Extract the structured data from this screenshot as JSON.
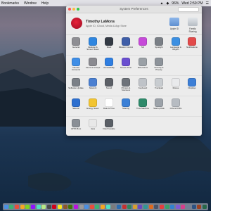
{
  "menubar": {
    "items": [
      "Bookmarks",
      "Window",
      "Help"
    ],
    "right": [
      "▲",
      "◆",
      "96%",
      "Wed 2:59 PM",
      "☰"
    ]
  },
  "window": {
    "title": "System Preferences",
    "traffic_colors": [
      "#fc5753",
      "#fdbc40",
      "#33c748"
    ]
  },
  "account": {
    "name": "Timothy LaMons",
    "subtitle": "Apple ID, iCloud, Media & App Store",
    "apple_id_label": "Apple ID",
    "family_label": "Family Sharing"
  },
  "rows": [
    [
      {
        "label": "General",
        "color": "#8e8e93",
        "icon": "general-icon"
      },
      {
        "label": "Desktop & Screen Saver",
        "color": "#2f86e0",
        "icon": "desktop-icon"
      },
      {
        "label": "Dock",
        "color": "#333a44",
        "icon": "dock-icon"
      },
      {
        "label": "Mission Control",
        "color": "#3f5ea8",
        "icon": "mission-control-icon"
      },
      {
        "label": "Siri",
        "color": "#c64ad9",
        "icon": "siri-icon"
      },
      {
        "label": "Spotlight",
        "color": "#7a7f86",
        "icon": "spotlight-icon"
      },
      {
        "label": "Language & Region",
        "color": "#3b8fe2",
        "icon": "globe-icon"
      },
      {
        "label": "Notifications",
        "color": "#e24a4a",
        "icon": "notifications-icon"
      }
    ],
    [
      {
        "label": "Internet Accounts",
        "color": "#3f8ee6",
        "icon": "at-icon"
      },
      {
        "label": "Users & Groups",
        "color": "#8a8a90",
        "icon": "users-icon"
      },
      {
        "label": "Accessibility",
        "color": "#2f7ee0",
        "icon": "accessibility-icon"
      },
      {
        "label": "Screen Time",
        "color": "#6a4fd0",
        "icon": "hourglass-icon"
      },
      {
        "label": "Extensions",
        "color": "#9aa0a6",
        "icon": "puzzle-icon"
      },
      {
        "label": "Security & Privacy",
        "color": "#8d939a",
        "icon": "house-lock-icon"
      }
    ],
    [
      {
        "label": "Software Update",
        "color": "#7b8087",
        "icon": "gear-icon"
      },
      {
        "label": "Network",
        "color": "#4a7fd1",
        "icon": "network-icon"
      },
      {
        "label": "Sound",
        "color": "#5b5f66",
        "icon": "speaker-icon"
      },
      {
        "label": "Printers & Scanners",
        "color": "#6e737a",
        "icon": "printer-icon"
      },
      {
        "label": "Keyboard",
        "color": "#bfc3c8",
        "icon": "keyboard-icon"
      },
      {
        "label": "Trackpad",
        "color": "#c8ccd0",
        "icon": "trackpad-icon"
      },
      {
        "label": "Mouse",
        "color": "#e9eaec",
        "icon": "mouse-icon"
      },
      {
        "label": "Displays",
        "color": "#3d7fd6",
        "icon": "display-icon"
      }
    ],
    [
      {
        "label": "Sidecar",
        "color": "#2d6fcf",
        "icon": "sidecar-icon"
      },
      {
        "label": "Energy Saver",
        "color": "#f2c431",
        "icon": "bulb-icon"
      },
      {
        "label": "Date & Time",
        "color": "#ffffff",
        "icon": "clock-icon"
      },
      {
        "label": "Sharing",
        "color": "#3a7fd6",
        "icon": "sharing-icon"
      },
      {
        "label": "Time Machine",
        "color": "#2e8a6a",
        "icon": "time-machine-icon"
      },
      {
        "label": "Startup Disk",
        "color": "#9ca2a9",
        "icon": "disk-icon"
      },
      {
        "label": "CDs & DVDs",
        "color": "#b7bcc2",
        "icon": "cd-icon"
      }
    ],
    [
      {
        "label": "APFS Boot",
        "color": "#8a8f96",
        "icon": "apfs-icon"
      },
      {
        "label": "Java",
        "color": "#e8e8e8",
        "icon": "java-icon"
      },
      {
        "label": "Flash Update",
        "color": "#5a5f66",
        "icon": "flash-update-icon"
      }
    ]
  ],
  "dock": {
    "colors": [
      "#4a90e2",
      "#3cb371",
      "#e94e3c",
      "#f5a623",
      "#7ed321",
      "#9013fe",
      "#50e3c2",
      "#b8e986",
      "#4a4a4a",
      "#d0021b",
      "#f8e71c",
      "#8b572a",
      "#417505",
      "#bd10e0",
      "#9b9b9b",
      "#4a90e2",
      "#e94e3c",
      "#3cb371",
      "#f5a623",
      "#50e3c2",
      "#7b7b7b",
      "#2b6cb0",
      "#c53030",
      "#2f855a",
      "#d69e2e",
      "#6b46c1",
      "#319795",
      "#dd6b20",
      "#4a5568",
      "#e53e3e",
      "#38a169",
      "#3182ce",
      "#805ad5",
      "#d53f8c",
      "#718096",
      "#2c5282",
      "#9c4221",
      "#276749"
    ]
  }
}
